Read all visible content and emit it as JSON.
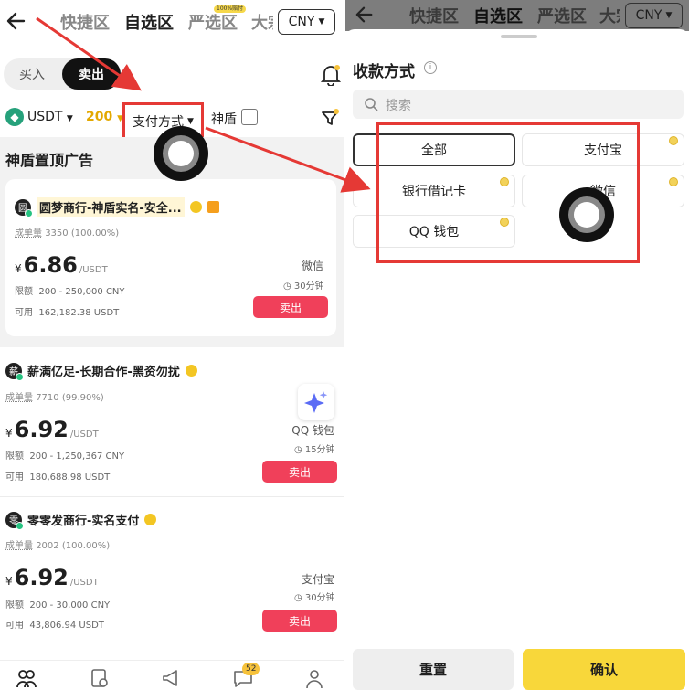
{
  "nav": {
    "tabs": [
      "快捷区",
      "自选区",
      "严选区",
      "大宗"
    ],
    "active_tab": "自选区",
    "promo_badge": "100%赔付",
    "currency": "CNY"
  },
  "trade_toggle": {
    "buy": "买入",
    "sell": "卖出"
  },
  "filters": {
    "asset": "USDT",
    "amount": "200",
    "payment": "支付方式",
    "shield": "神盾"
  },
  "section_title": "神盾置顶广告",
  "ads": [
    {
      "avatar": "圆",
      "merchant": "圆梦商行-神盾实名-安全...",
      "orders": "成单量",
      "orders_value": "3350 (100.00%)",
      "currency_symbol": "¥",
      "price": "6.86",
      "unit": "/USDT",
      "limit_label": "限额",
      "limit": "200 - 250,000 CNY",
      "avail_label": "可用",
      "available": "162,182.38 USDT",
      "method": "微信",
      "time": "30分钟",
      "action": "卖出"
    },
    {
      "avatar": "薪",
      "merchant": "薪满亿足-长期合作-黑资勿扰",
      "orders": "成单量",
      "orders_value": "7710 (99.90%)",
      "currency_symbol": "¥",
      "price": "6.92",
      "unit": "/USDT",
      "limit_label": "限额",
      "limit": "200 - 1,250,367 CNY",
      "avail_label": "可用",
      "available": "180,688.98 USDT",
      "method": "QQ 钱包",
      "time": "15分钟",
      "action": "卖出"
    },
    {
      "avatar": "零",
      "merchant": "零零发商行-实名支付",
      "orders": "成单量",
      "orders_value": "2002 (100.00%)",
      "currency_symbol": "¥",
      "price": "6.92",
      "unit": "/USDT",
      "limit_label": "限额",
      "limit": "200 - 30,000 CNY",
      "avail_label": "可用",
      "available": "43,806.94 USDT",
      "method": "支付宝",
      "time": "30分钟",
      "action": "卖出"
    }
  ],
  "bottom_nav": {
    "badge": "52"
  },
  "sheet": {
    "title": "收款方式",
    "info": "i",
    "search_placeholder": "搜索",
    "options": [
      "全部",
      "支付宝",
      "银行借记卡",
      "微信",
      "QQ 钱包"
    ],
    "selected": "全部",
    "reset": "重置",
    "confirm": "确认"
  },
  "colors": {
    "accent": "#f8d73a",
    "sell": "#f0405a",
    "highlight_box": "#e53935"
  }
}
